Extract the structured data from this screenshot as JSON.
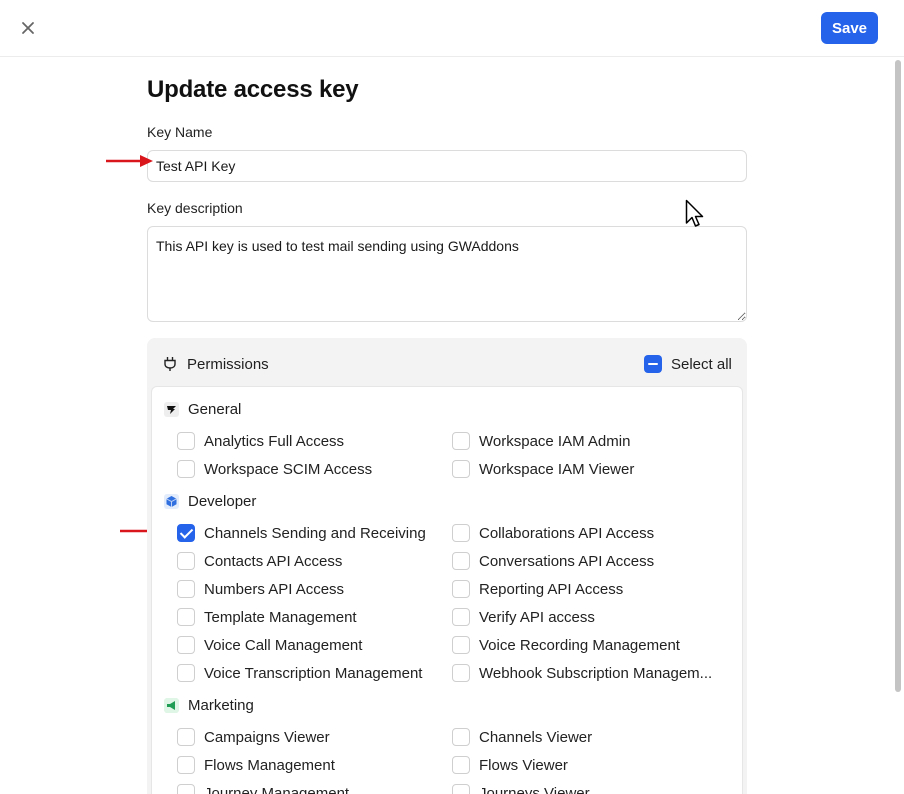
{
  "toolbar": {
    "save_label": "Save"
  },
  "page": {
    "title": "Update access key"
  },
  "form": {
    "name_label": "Key Name",
    "name_value": "Test API Key",
    "desc_label": "Key description",
    "desc_value": "This API key is used to test mail sending using GWAddons"
  },
  "permissions": {
    "title": "Permissions",
    "select_all_label": "Select all",
    "groups": [
      {
        "name": "General",
        "items": [
          {
            "label": "Analytics Full Access",
            "checked": false
          },
          {
            "label": "Workspace IAM Admin",
            "checked": false
          },
          {
            "label": "Workspace SCIM Access",
            "checked": false
          },
          {
            "label": "Workspace IAM Viewer",
            "checked": false
          }
        ]
      },
      {
        "name": "Developer",
        "items": [
          {
            "label": "Channels Sending and Receiving",
            "checked": true
          },
          {
            "label": "Collaborations API Access",
            "checked": false
          },
          {
            "label": "Contacts API Access",
            "checked": false
          },
          {
            "label": "Conversations API Access",
            "checked": false
          },
          {
            "label": "Numbers API Access",
            "checked": false
          },
          {
            "label": "Reporting API Access",
            "checked": false
          },
          {
            "label": "Template Management",
            "checked": false
          },
          {
            "label": "Verify API access",
            "checked": false
          },
          {
            "label": "Voice Call Management",
            "checked": false
          },
          {
            "label": "Voice Recording Management",
            "checked": false
          },
          {
            "label": "Voice Transcription Management",
            "checked": false
          },
          {
            "label": "Webhook Subscription Managem...",
            "checked": false
          }
        ]
      },
      {
        "name": "Marketing",
        "items": [
          {
            "label": "Campaigns Viewer",
            "checked": false
          },
          {
            "label": "Channels Viewer",
            "checked": false
          },
          {
            "label": "Flows Management",
            "checked": false
          },
          {
            "label": "Flows Viewer",
            "checked": false
          },
          {
            "label": "Journey Management",
            "checked": false
          },
          {
            "label": "Journeys Viewer",
            "checked": false
          }
        ]
      }
    ]
  },
  "icons": {
    "close": "close-icon",
    "permissions": "plug-icon",
    "general": "bird-logo-icon",
    "developer": "developer-cube-icon",
    "marketing": "megaphone-icon",
    "annotation": "red-arrow-icon",
    "cursor": "mouse-pointer-icon"
  },
  "colors": {
    "accent": "#2563eb",
    "annotation": "#d9161c"
  }
}
